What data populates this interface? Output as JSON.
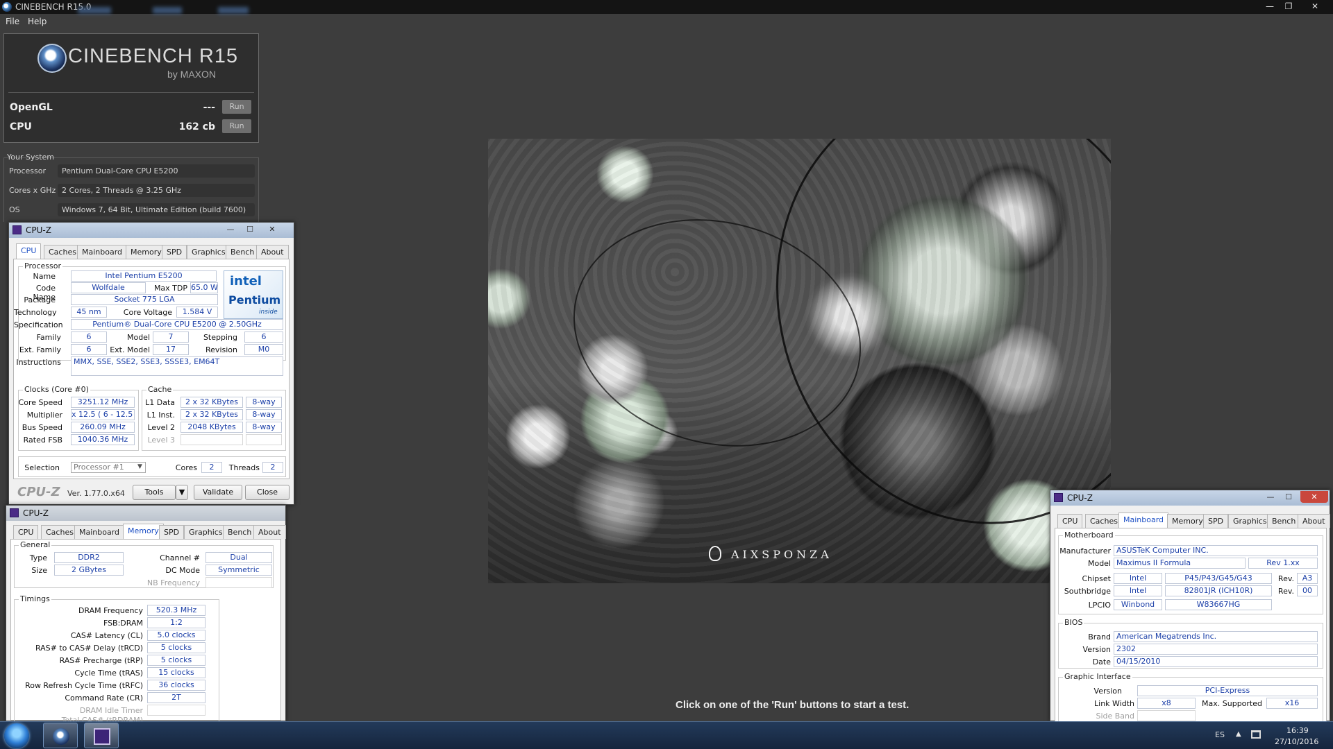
{
  "window": {
    "title": "CINEBENCH R15.0",
    "controls": {
      "minimize": "—",
      "restore": "❐",
      "close": "✕"
    }
  },
  "menu": {
    "file": "File",
    "help": "Help"
  },
  "cinebench": {
    "logo": "CINEBENCH R15",
    "logo_sub": "by MAXON",
    "opengl": {
      "label": "OpenGL",
      "value": "---",
      "run": "Run"
    },
    "cpu": {
      "label": "CPU",
      "value": "162 cb",
      "run": "Run"
    },
    "your_system": {
      "title": "Your System",
      "rows": [
        {
          "label": "Processor",
          "value": "Pentium Dual-Core CPU E5200"
        },
        {
          "label": "Cores x GHz",
          "value": "2 Cores, 2 Threads @ 3.25 GHz"
        },
        {
          "label": "OS",
          "value": "Windows 7, 64 Bit, Ultimate Edition (build 7600)"
        }
      ]
    },
    "hint": "Click on one of the 'Run' buttons to start a test.",
    "render_brand": "AIXSPONZA"
  },
  "cpuz_cpu": {
    "title": "CPU-Z",
    "tabs": [
      "CPU",
      "Caches",
      "Mainboard",
      "Memory",
      "SPD",
      "Graphics",
      "Bench",
      "About"
    ],
    "active_tab": "CPU",
    "processor": {
      "group": "Processor",
      "name_label": "Name",
      "name": "Intel Pentium E5200",
      "code_label": "Code Name",
      "code": "Wolfdale",
      "tdp_label": "Max TDP",
      "tdp": "65.0 W",
      "package_label": "Package",
      "package": "Socket 775 LGA",
      "tech_label": "Technology",
      "tech": "45 nm",
      "voltage_label": "Core Voltage",
      "voltage": "1.584 V",
      "spec_label": "Specification",
      "spec": "Pentium® Dual-Core  CPU     E5200  @ 2.50GHz",
      "family_label": "Family",
      "family": "6",
      "model_label": "Model",
      "model": "7",
      "stepping_label": "Stepping",
      "stepping": "6",
      "extfamily_label": "Ext. Family",
      "extfamily": "6",
      "extmodel_label": "Ext. Model",
      "extmodel": "17",
      "revision_label": "Revision",
      "revision": "M0",
      "instr_label": "Instructions",
      "instr": "MMX, SSE, SSE2, SSE3, SSSE3, EM64T",
      "logo_intel": "intel",
      "logo_pentium": "Pentium",
      "logo_inside": "inside"
    },
    "clocks": {
      "group": "Clocks (Core #0)",
      "core_speed_label": "Core Speed",
      "core_speed": "3251.12 MHz",
      "multiplier_label": "Multiplier",
      "multiplier": "x 12.5 ( 6 - 12.5 )",
      "bus_label": "Bus Speed",
      "bus": "260.09 MHz",
      "fsb_label": "Rated FSB",
      "fsb": "1040.36 MHz"
    },
    "cache": {
      "group": "Cache",
      "l1d_label": "L1 Data",
      "l1d": "2 x 32 KBytes",
      "l1d_way": "8-way",
      "l1i_label": "L1 Inst.",
      "l1i": "2 x 32 KBytes",
      "l1i_way": "8-way",
      "l2_label": "Level 2",
      "l2": "2048 KBytes",
      "l2_way": "8-way",
      "l3_label": "Level 3"
    },
    "selection_label": "Selection",
    "selection": "Processor #1",
    "cores_label": "Cores",
    "cores": "2",
    "threads_label": "Threads",
    "threads": "2",
    "brand": "CPU-Z",
    "version": "Ver. 1.77.0.x64",
    "tools": "Tools",
    "validate": "Validate",
    "close": "Close"
  },
  "cpuz_mem": {
    "title": "CPU-Z",
    "tabs": [
      "CPU",
      "Caches",
      "Mainboard",
      "Memory",
      "SPD",
      "Graphics",
      "Bench",
      "About"
    ],
    "active_tab": "Memory",
    "general": {
      "group": "General",
      "type_label": "Type",
      "type": "DDR2",
      "channel_label": "Channel #",
      "channel": "Dual",
      "size_label": "Size",
      "size": "2 GBytes",
      "dc_label": "DC Mode",
      "dc": "Symmetric",
      "nb_label": "NB Frequency"
    },
    "timings": {
      "group": "Timings",
      "rows": [
        {
          "label": "DRAM Frequency",
          "value": "520.3 MHz"
        },
        {
          "label": "FSB:DRAM",
          "value": "1:2"
        },
        {
          "label": "CAS# Latency (CL)",
          "value": "5.0 clocks"
        },
        {
          "label": "RAS# to CAS# Delay (tRCD)",
          "value": "5 clocks"
        },
        {
          "label": "RAS# Precharge (tRP)",
          "value": "5 clocks"
        },
        {
          "label": "Cycle Time (tRAS)",
          "value": "15 clocks"
        },
        {
          "label": "Row Refresh Cycle Time (tRFC)",
          "value": "36 clocks"
        },
        {
          "label": "Command Rate (CR)",
          "value": "2T"
        }
      ],
      "idle_label": "DRAM Idle Timer",
      "total_cas_label": "Total CAS# (tRDRAM)"
    }
  },
  "cpuz_mb": {
    "title": "CPU-Z",
    "tabs": [
      "CPU",
      "Caches",
      "Mainboard",
      "Memory",
      "SPD",
      "Graphics",
      "Bench",
      "About"
    ],
    "active_tab": "Mainboard",
    "motherboard": {
      "group": "Motherboard",
      "manufacturer_label": "Manufacturer",
      "manufacturer": "ASUSTeK Computer INC.",
      "model_label": "Model",
      "model": "Maximus II Formula",
      "model_rev": "Rev 1.xx",
      "chipset_label": "Chipset",
      "chipset_vendor": "Intel",
      "chipset": "P45/P43/G45/G43",
      "chipset_rev_label": "Rev.",
      "chipset_rev": "A3",
      "south_label": "Southbridge",
      "south_vendor": "Intel",
      "south": "82801JR (ICH10R)",
      "south_rev_label": "Rev.",
      "south_rev": "00",
      "lpcio_label": "LPCIO",
      "lpcio_vendor": "Winbond",
      "lpcio": "W83667HG"
    },
    "bios": {
      "group": "BIOS",
      "brand_label": "Brand",
      "brand": "American Megatrends Inc.",
      "version_label": "Version",
      "version": "2302",
      "date_label": "Date",
      "date": "04/15/2010"
    },
    "graphic": {
      "group": "Graphic Interface",
      "version_label": "Version",
      "version": "PCI-Express",
      "link_label": "Link Width",
      "link": "x8",
      "max_label": "Max. Supported",
      "max": "x16",
      "sideband_label": "Side Band Addressing"
    }
  },
  "taskbar": {
    "lang": "ES",
    "tray_arrow": "▲",
    "time": "16:39",
    "date": "27/10/2016"
  }
}
